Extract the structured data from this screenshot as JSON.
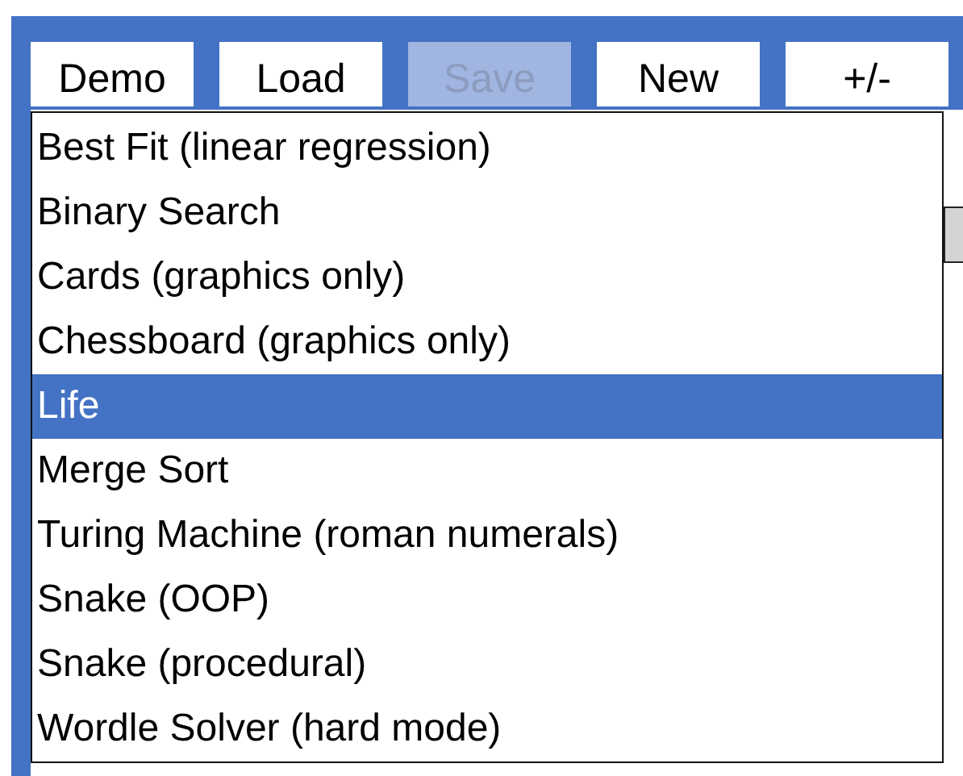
{
  "toolbar": {
    "buttons": [
      {
        "label": "Demo",
        "disabled": false
      },
      {
        "label": "Load",
        "disabled": false
      },
      {
        "label": "Save",
        "disabled": true
      },
      {
        "label": "New",
        "disabled": false
      },
      {
        "label": "+/-",
        "disabled": false
      }
    ]
  },
  "demo_menu": {
    "items": [
      {
        "label": "Best Fit (linear regression)",
        "selected": false
      },
      {
        "label": "Binary Search",
        "selected": false
      },
      {
        "label": "Cards (graphics only)",
        "selected": false
      },
      {
        "label": "Chessboard (graphics only)",
        "selected": false
      },
      {
        "label": "Life",
        "selected": true
      },
      {
        "label": "Merge Sort",
        "selected": false
      },
      {
        "label": "Turing Machine (roman numerals)",
        "selected": false
      },
      {
        "label": "Snake (OOP)",
        "selected": false
      },
      {
        "label": "Snake (procedural)",
        "selected": false
      },
      {
        "label": "Wordle Solver (hard mode)",
        "selected": false
      }
    ]
  }
}
